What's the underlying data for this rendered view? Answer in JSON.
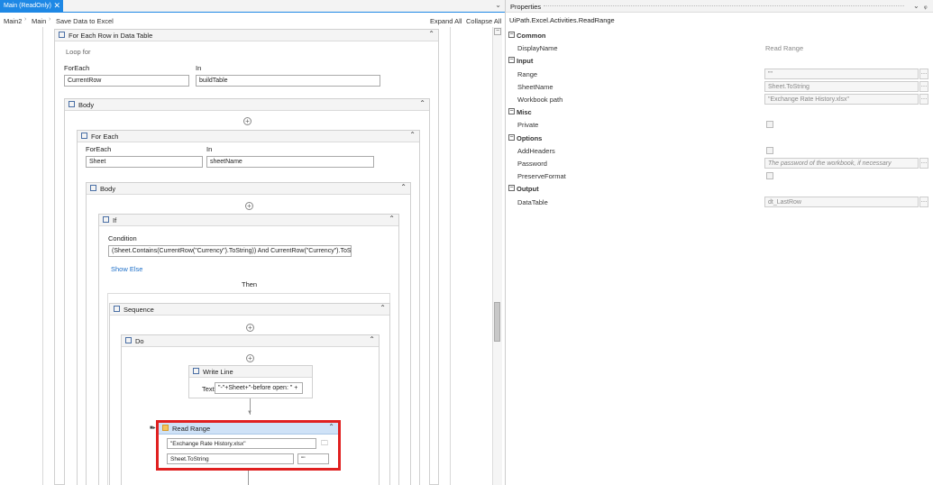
{
  "tab": {
    "title": "Main (ReadOnly)"
  },
  "breadcrumb": {
    "items": [
      "Main2",
      "Main",
      "Save Data to Excel"
    ],
    "expand_all": "Expand All",
    "collapse_all": "Collapse All"
  },
  "workflow": {
    "foreach_row": {
      "title": "For Each Row in Data Table",
      "loop_label": "Loop for",
      "foreach_label": "ForEach",
      "foreach_value": "CurrentRow",
      "in_label": "In",
      "in_value": "buildTable"
    },
    "body1": {
      "title": "Body"
    },
    "foreach": {
      "title": "For Each",
      "foreach_label": "ForEach",
      "foreach_value": "Sheet",
      "in_label": "In",
      "in_value": "sheetName"
    },
    "body2": {
      "title": "Body"
    },
    "if": {
      "title": "If",
      "condition_label": "Condition",
      "condition_value": "(Sheet.Contains(CurrentRow(\"Currency\").ToString)) And CurrentRow(\"Currency\").ToSt",
      "show_else": "Show Else",
      "then_label": "Then"
    },
    "sequence": {
      "title": "Sequence"
    },
    "do": {
      "title": "Do"
    },
    "write_line": {
      "title": "Write Line",
      "text_label": "Text",
      "text_value": "\"-\"+Sheet+\"-before open: \" +"
    },
    "read_range": {
      "title": "Read Range",
      "workbook_value": "\"Exchange Rate History.xlsx\"",
      "sheet_value": "Sheet.ToString",
      "range_value": "\"\""
    }
  },
  "properties": {
    "title": "Properties",
    "activity": "UiPath.Excel.Activities.ReadRange",
    "categories": [
      {
        "name": "Common",
        "rows": [
          {
            "name": "DisplayName",
            "value": "Read Range",
            "kind": "text"
          }
        ]
      },
      {
        "name": "Input",
        "rows": [
          {
            "name": "Range",
            "value": "\"\"",
            "kind": "field"
          },
          {
            "name": "SheetName",
            "value": "Sheet.ToString",
            "kind": "field"
          },
          {
            "name": "Workbook path",
            "value": "\"Exchange Rate History.xlsx\"",
            "kind": "field"
          }
        ]
      },
      {
        "name": "Misc",
        "rows": [
          {
            "name": "Private",
            "value": "",
            "kind": "check"
          }
        ]
      },
      {
        "name": "Options",
        "rows": [
          {
            "name": "AddHeaders",
            "value": "",
            "kind": "check"
          },
          {
            "name": "Password",
            "value": "The password of the workbook, if necessary",
            "kind": "field"
          },
          {
            "name": "PreserveFormat",
            "value": "",
            "kind": "check"
          }
        ]
      },
      {
        "name": "Output",
        "rows": [
          {
            "name": "DataTable",
            "value": "dt_LastRow",
            "kind": "field"
          }
        ]
      }
    ]
  },
  "colors": {
    "accent": "#1e88e5",
    "selected": "#e02020",
    "header": "#f4f4f4"
  }
}
